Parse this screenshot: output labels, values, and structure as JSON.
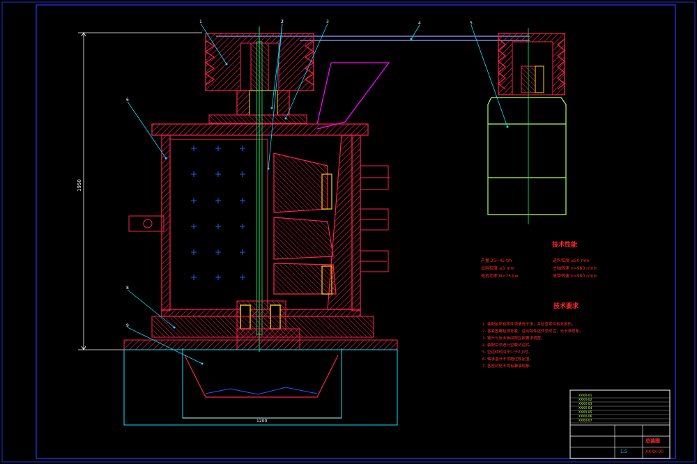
{
  "colors": {
    "background": "#000000",
    "frame": "#1f2fd0",
    "section": "#ff2050",
    "hatch": "#ff2050",
    "centerline": "#00ff66",
    "dimension": "#ffffff",
    "leader": "#00e5ff",
    "motor": "#b6ff4a",
    "bearing": "#ffd400",
    "belt": "#9aa0ff",
    "feed": "#ff00ff",
    "heading_text": "#ff2a2a",
    "note_text": "#ff3030"
  },
  "balloons": [
    "1",
    "2",
    "3",
    "4",
    "5",
    "6",
    "7",
    "8",
    "9"
  ],
  "dimensions": {
    "height_label": "1950",
    "base_width_label": "1200"
  },
  "tech_performance": {
    "heading": "技术性能",
    "rows": [
      "产量 25~45 t/h",
      "进料粒度 ≤50 mm",
      "出料粒度 ≤5 mm",
      "主轴转速 n=980 r/min",
      "电机功率 N=75 kw",
      "皮带转速 n=980 r/min"
    ]
  },
  "tech_requirements": {
    "heading": "技术要求",
    "items": [
      "1. 装配前所有零件须清洗干净，并检查零件有无损伤。",
      "2. 各紧固螺栓须拧紧，运动部件运转须灵活，无卡滞现象。",
      "3. 锤头与反击板间隙应按要求调整。",
      "4. 装配后须进行空载试运转。",
      "5. 空运转时间不少于2小时。",
      "6. 轴承温升不得超过规定值。",
      "7. 各密封处不得有漏油现象。"
    ]
  },
  "title_block": {
    "drawing_name": "总装图",
    "code": "XXXX-00",
    "scale": "1:5",
    "parts": [
      "XXXX-01",
      "XXXX-02",
      "XXXX-03",
      "XXXX-04",
      "XXXX-05",
      "XXXX-06",
      "XXXX-07"
    ]
  }
}
